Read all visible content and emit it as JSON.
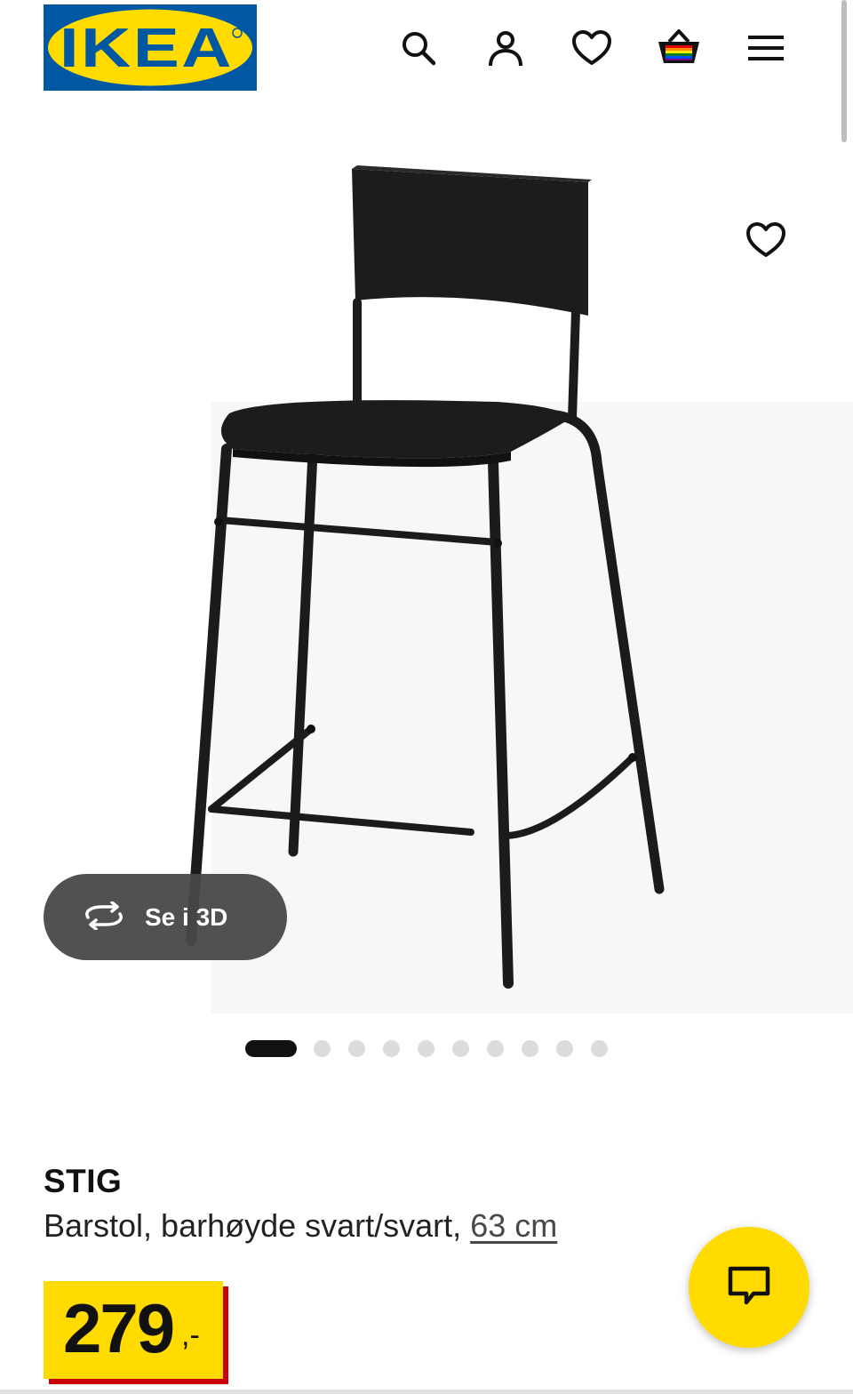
{
  "header": {
    "logo_text": "IKEA",
    "icons": [
      "search-icon",
      "account-icon",
      "heart-icon",
      "basket-icon",
      "menu-icon"
    ]
  },
  "gallery": {
    "view_3d_label": "Se i 3D",
    "slide_count": 10,
    "active_slide": 1
  },
  "product": {
    "name": "STIG",
    "description": "Barstol, barhøyde svart/svart,",
    "size_link": "63 cm",
    "price_integer": "279",
    "price_suffix": ",-"
  },
  "colors": {
    "ikea_blue": "#0058a3",
    "ikea_yellow": "#ffdb00",
    "price_shadow_red": "#cc0008",
    "text_dark": "#111111"
  }
}
